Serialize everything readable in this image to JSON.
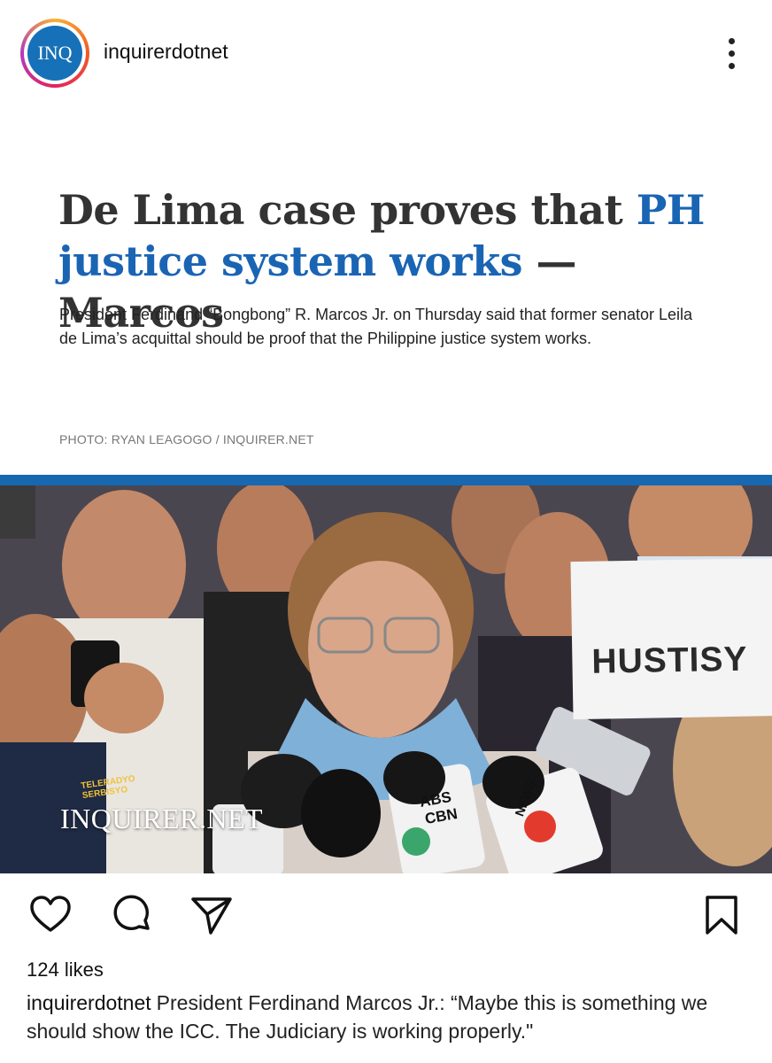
{
  "header": {
    "avatar_text": "INQ",
    "username": "inquirerdotnet",
    "more_icon": "more-vertical-icon"
  },
  "article": {
    "headline_part1": "De Lima case proves that ",
    "headline_highlight": "PH justice system works",
    "headline_part2": " — Marcos",
    "summary": "President Ferdinand “Bongbong” R. Marcos Jr. on Thursday said that former senator Leila de Lima’s acquittal should be proof that the Philippine justice system works.",
    "photo_credit": "PHOTO: RYAN LEAGOGO / INQUIRER.NET",
    "accent_color": "#1a64b4"
  },
  "photo": {
    "watermark": "INQUIRER.NET",
    "sign_text": "HUSTISY",
    "mic_label_1": "ABS",
    "mic_label_2": "CBN",
    "mic_label_3": "NEWS",
    "shirt_text": "TELERADYO SERBISYO"
  },
  "actions": {
    "like_icon": "heart-icon",
    "comment_icon": "comment-icon",
    "share_icon": "send-icon",
    "save_icon": "bookmark-icon"
  },
  "post": {
    "likes": "124 likes",
    "caption_user": "inquirerdotnet",
    "caption_text": "President Ferdinand Marcos Jr.: “Maybe this is something we should show the ICC. The Judiciary is working properly.\""
  }
}
